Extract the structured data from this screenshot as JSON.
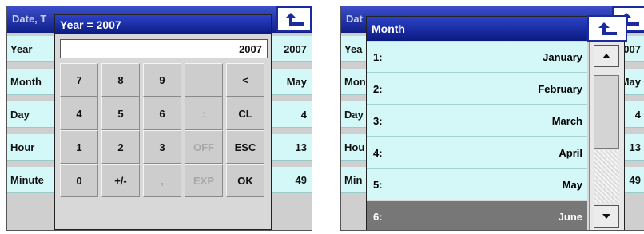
{
  "left": {
    "bg_title": "Date, T",
    "rows": [
      {
        "label": "Year",
        "value": "2007"
      },
      {
        "label": "Month",
        "value": "May"
      },
      {
        "label": "Day",
        "value": "4"
      },
      {
        "label": "Hour",
        "value": "13"
      },
      {
        "label": "Minute",
        "value": "49"
      }
    ],
    "dialog": {
      "title": "Year = 2007",
      "input_value": "2007",
      "keys": [
        "7",
        "8",
        "9",
        "",
        "<",
        "4",
        "5",
        "6",
        ":",
        "CL",
        "1",
        "2",
        "3",
        "OFF",
        "ESC",
        "0",
        "+/-",
        ",",
        "EXP",
        "OK"
      ],
      "disabled_keys": [
        ":",
        "OFF",
        ",",
        "EXP"
      ]
    }
  },
  "right": {
    "bg_title": "Dat",
    "rows": [
      {
        "label": "Yea",
        "value": "007"
      },
      {
        "label": "Mon",
        "value": "May"
      },
      {
        "label": "Day",
        "value": "4"
      },
      {
        "label": "Hou",
        "value": "13"
      },
      {
        "label": "Min",
        "value": "49"
      }
    ],
    "dialog": {
      "title": "Month",
      "items": [
        {
          "num": "1:",
          "name": "January"
        },
        {
          "num": "2:",
          "name": "February"
        },
        {
          "num": "3:",
          "name": "March"
        },
        {
          "num": "4:",
          "name": "April"
        },
        {
          "num": "5:",
          "name": "May"
        },
        {
          "num": "6:",
          "name": "June"
        }
      ],
      "selected_index": 5
    }
  },
  "colors": {
    "title_bar": "#1a2aa0",
    "row_bg": "#d4f7f7",
    "selected_row": "#777777"
  },
  "icons": {
    "back": "return-arrow-icon",
    "scroll_up": "scroll-up-arrow-icon",
    "scroll_down": "scroll-down-arrow-icon"
  }
}
